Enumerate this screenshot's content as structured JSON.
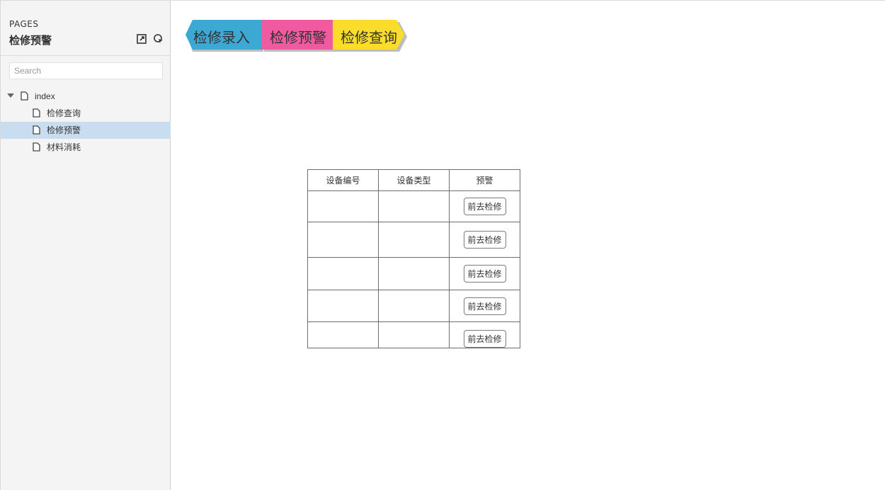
{
  "sidebar": {
    "pages_label": "PAGES",
    "title": "检修预警",
    "search": {
      "placeholder": "Search",
      "value": ""
    },
    "tree": [
      {
        "label": "index",
        "expanded": true,
        "selected": false,
        "depth": 0
      },
      {
        "label": "检修查询",
        "selected": false,
        "depth": 1
      },
      {
        "label": "检修预警",
        "selected": true,
        "depth": 1
      },
      {
        "label": "材料消耗",
        "selected": false,
        "depth": 1
      }
    ],
    "icons": {
      "export": "export-icon",
      "pointer": "pointer-icon"
    }
  },
  "nav": [
    {
      "label": "检修录入",
      "color": "#3ba9d3"
    },
    {
      "label": "检修预警",
      "color": "#ef5aa1"
    },
    {
      "label": "检修查询",
      "color": "#fadd2b"
    }
  ],
  "table": {
    "headers": [
      "设备编号",
      "设备类型",
      "预警"
    ],
    "rows": [
      {
        "id": "",
        "type": "",
        "action": "前去检修"
      },
      {
        "id": "",
        "type": "",
        "action": "前去检修"
      },
      {
        "id": "",
        "type": "",
        "action": "前去检修"
      },
      {
        "id": "",
        "type": "",
        "action": "前去检修"
      },
      {
        "id": "",
        "type": "",
        "action": "前去检修"
      }
    ]
  }
}
